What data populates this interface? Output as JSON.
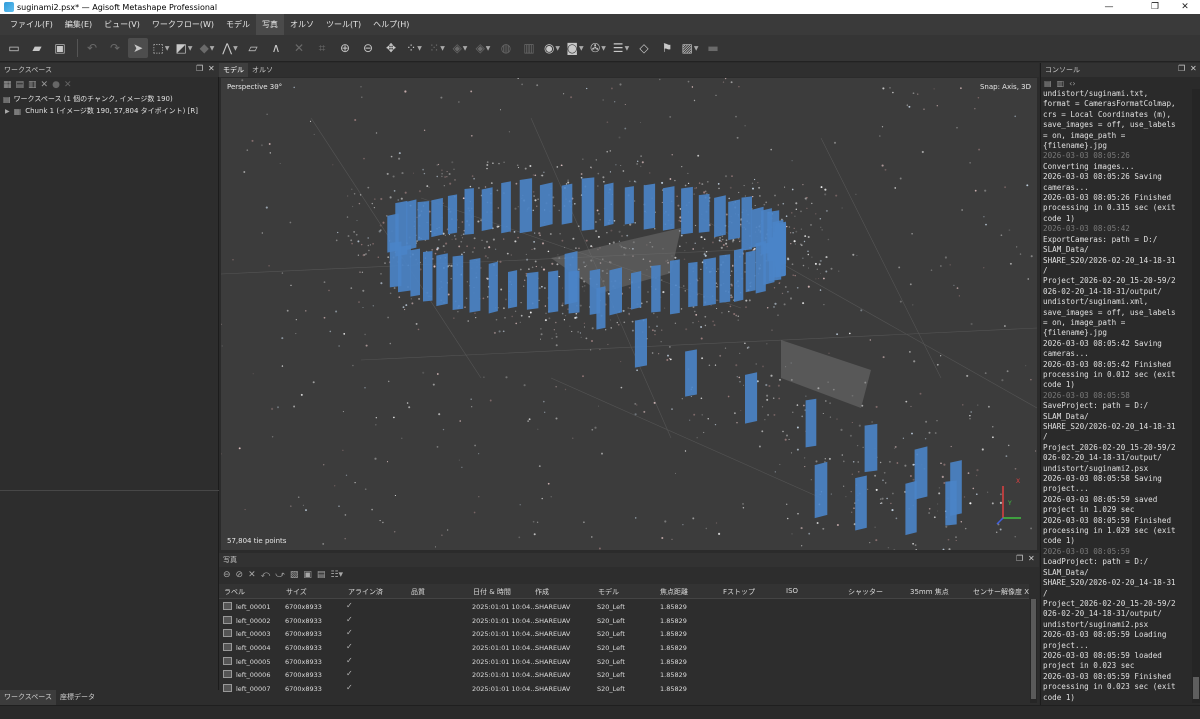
{
  "window": {
    "title": "suginami2.psx* — Agisoft Metashape Professional",
    "minimize": "—",
    "maximize": "❐",
    "close": "✕"
  },
  "menu": [
    "ファイル(F)",
    "編集(E)",
    "ビュー(V)",
    "ワークフロー(W)",
    "モデル",
    "写真",
    "オルソ",
    "ツール(T)",
    "ヘルプ(H)"
  ],
  "workspace": {
    "header": "ワークスペース",
    "root": "ワークスペース (1 個のチャンク, イメージ数 190)",
    "chunk": "Chunk 1 (イメージ数 190, 57,804 タイポイント) [R]"
  },
  "bottom_tabs": [
    "ワークスペース",
    "座標データ"
  ],
  "view_tabs": [
    "モデル",
    "オルソ"
  ],
  "viewport": {
    "projection": "Perspective 30°",
    "snap": "Snap: Axis, 3D",
    "points": "57,804 tie points",
    "axis_x": "X",
    "axis_y": "Y"
  },
  "photos": {
    "header": "写真",
    "columns": [
      "ラベル",
      "サイズ",
      "アライン済",
      "品質",
      "日付 & 時間",
      "作成",
      "モデル",
      "焦点距離",
      "Fストップ",
      "ISO",
      "シャッター",
      "35mm 焦点",
      "センサー解像度 X"
    ],
    "rows": [
      {
        "label": "left_00001",
        "size": "6700x8933",
        "date": "2025:01:01 10:04...",
        "make": "SHAREUAV",
        "model": "S20_Left",
        "focal": "1.85829"
      },
      {
        "label": "left_00002",
        "size": "6700x8933",
        "date": "2025:01:01 10:04...",
        "make": "SHAREUAV",
        "model": "S20_Left",
        "focal": "1.85829"
      },
      {
        "label": "left_00003",
        "size": "6700x8933",
        "date": "2025:01:01 10:04...",
        "make": "SHAREUAV",
        "model": "S20_Left",
        "focal": "1.85829"
      },
      {
        "label": "left_00004",
        "size": "6700x8933",
        "date": "2025:01:01 10:04...",
        "make": "SHAREUAV",
        "model": "S20_Left",
        "focal": "1.85829"
      },
      {
        "label": "left_00005",
        "size": "6700x8933",
        "date": "2025:01:01 10:04...",
        "make": "SHAREUAV",
        "model": "S20_Left",
        "focal": "1.85829"
      },
      {
        "label": "left_00006",
        "size": "6700x8933",
        "date": "2025:01:01 10:04...",
        "make": "SHAREUAV",
        "model": "S20_Left",
        "focal": "1.85829"
      },
      {
        "label": "left_00007",
        "size": "6700x8933",
        "date": "2025:01:01 10:04...",
        "make": "SHAREUAV",
        "model": "S20_Left",
        "focal": "1.85829"
      }
    ]
  },
  "console": {
    "header": "コンソール",
    "lines": [
      {
        "t": "undistort/suginami.txt,",
        "ts": false
      },
      {
        "t": "format = CamerasFormatColmap,",
        "ts": false
      },
      {
        "t": "crs = Local Coordinates (m),",
        "ts": false
      },
      {
        "t": "save_images = off, use_labels",
        "ts": false
      },
      {
        "t": "= on, image_path =",
        "ts": false
      },
      {
        "t": "{filename}.jpg",
        "ts": false
      },
      {
        "t": "2026-03-03 08:05:26",
        "ts": true
      },
      {
        "t": "Converting images...",
        "ts": false
      },
      {
        "t": "2026-03-03 08:05:26 Saving",
        "ts": false
      },
      {
        "t": "cameras...",
        "ts": false
      },
      {
        "t": "2026-03-03 08:05:26 Finished",
        "ts": false
      },
      {
        "t": "processing in 0.315 sec (exit",
        "ts": false
      },
      {
        "t": "code 1)",
        "ts": false
      },
      {
        "t": "2026-03-03 08:05:42",
        "ts": true
      },
      {
        "t": "ExportCameras: path = D:/",
        "ts": false
      },
      {
        "t": "SLAM_Data/",
        "ts": false
      },
      {
        "t": "SHARE_S20/2026-02-20_14-18-31",
        "ts": false
      },
      {
        "t": "/",
        "ts": false
      },
      {
        "t": "Project_2026-02-20_15-20-59/2",
        "ts": false
      },
      {
        "t": "026-02-20_14-18-31/output/",
        "ts": false
      },
      {
        "t": "undistort/suginami.xml,",
        "ts": false
      },
      {
        "t": "save_images = off, use_labels",
        "ts": false
      },
      {
        "t": "= on, image_path =",
        "ts": false
      },
      {
        "t": "{filename}.jpg",
        "ts": false
      },
      {
        "t": "2026-03-03 08:05:42 Saving",
        "ts": false
      },
      {
        "t": "cameras...",
        "ts": false
      },
      {
        "t": "2026-03-03 08:05:42 Finished",
        "ts": false
      },
      {
        "t": "processing in 0.012 sec (exit",
        "ts": false
      },
      {
        "t": "code 1)",
        "ts": false
      },
      {
        "t": "2026-03-03 08:05:58",
        "ts": true
      },
      {
        "t": "SaveProject: path = D:/",
        "ts": false
      },
      {
        "t": "SLAM_Data/",
        "ts": false
      },
      {
        "t": "SHARE_S20/2026-02-20_14-18-31",
        "ts": false
      },
      {
        "t": "/",
        "ts": false
      },
      {
        "t": "Project_2026-02-20_15-20-59/2",
        "ts": false
      },
      {
        "t": "026-02-20_14-18-31/output/",
        "ts": false
      },
      {
        "t": "undistort/suginami2.psx",
        "ts": false
      },
      {
        "t": "2026-03-03 08:05:58 Saving",
        "ts": false
      },
      {
        "t": "project...",
        "ts": false
      },
      {
        "t": "2026-03-03 08:05:59 saved",
        "ts": false
      },
      {
        "t": "project in 1.029 sec",
        "ts": false
      },
      {
        "t": "2026-03-03 08:05:59 Finished",
        "ts": false
      },
      {
        "t": "processing in 1.029 sec (exit",
        "ts": false
      },
      {
        "t": "code 1)",
        "ts": false
      },
      {
        "t": "2026-03-03 08:05:59",
        "ts": true
      },
      {
        "t": "LoadProject: path = D:/",
        "ts": false
      },
      {
        "t": "SLAM_Data/",
        "ts": false
      },
      {
        "t": "SHARE_S20/2026-02-20_14-18-31",
        "ts": false
      },
      {
        "t": "/",
        "ts": false
      },
      {
        "t": "Project_2026-02-20_15-20-59/2",
        "ts": false
      },
      {
        "t": "026-02-20_14-18-31/output/",
        "ts": false
      },
      {
        "t": "undistort/suginami2.psx",
        "ts": false
      },
      {
        "t": "2026-03-03 08:05:59 Loading",
        "ts": false
      },
      {
        "t": "project...",
        "ts": false
      },
      {
        "t": "2026-03-03 08:05:59 loaded",
        "ts": false
      },
      {
        "t": "project in 0.023 sec",
        "ts": false
      },
      {
        "t": "2026-03-03 08:05:59 Finished",
        "ts": false
      },
      {
        "t": "processing in 0.023 sec (exit",
        "ts": false
      },
      {
        "t": "code 1)",
        "ts": false
      },
      {
        "t": ">>>",
        "ts": false
      }
    ]
  },
  "colors": {
    "camera_blue": "#4a84c8",
    "viewport_bg": "#3c3c3c",
    "panel_bg": "#2d2d2d"
  }
}
